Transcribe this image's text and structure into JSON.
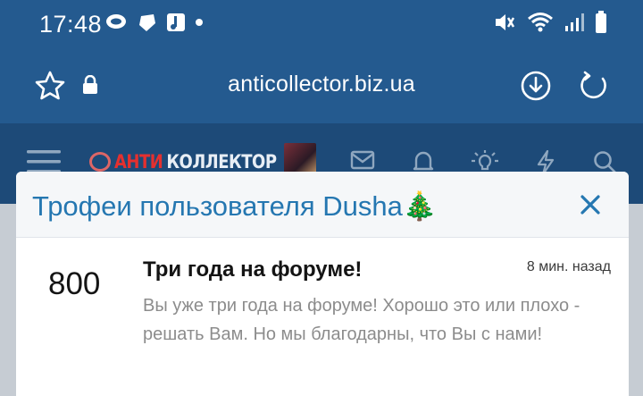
{
  "status_bar": {
    "time": "17:48"
  },
  "browser": {
    "url": "anticollector.biz.ua"
  },
  "site_header": {
    "logo_red": "АНТИ",
    "logo_white": "КОЛЛЕКТОР"
  },
  "modal": {
    "title": "Трофеи пользователя Dusha🎄",
    "close_glyph": "×",
    "trophy": {
      "points": "800",
      "title": "Три года на форуме!",
      "time": "8 мин. назад",
      "description": "Вы уже три года на форуме! Хорошо это или плохо - решать Вам. Но мы благодарны, что Вы с нами!"
    }
  },
  "colors": {
    "status_bar_bg": "#245a8f",
    "site_header_bg": "#1d4a78",
    "title_blue": "#2577b1",
    "logo_red": "#e4302f"
  },
  "icons": [
    "wifi-icon",
    "signal-icon",
    "battery-icon",
    "mute-icon",
    "star-icon",
    "lock-icon",
    "download-icon",
    "reload-icon",
    "menu-icon",
    "mail-icon",
    "bell-icon",
    "lightbulb-icon",
    "lightning-icon",
    "search-icon",
    "close-icon"
  ]
}
